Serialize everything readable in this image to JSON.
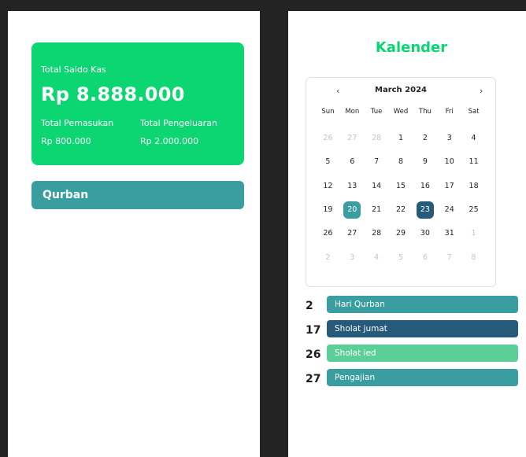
{
  "left": {
    "saldo": {
      "label": "Total Saldo Kas",
      "value": "Rp 8.888.000",
      "pemasukan_label": "Total Pemasukan",
      "pemasukan_value": "Rp 800.000",
      "pengeluaran_label": "Total Pengeluaran",
      "pengeluaran_value": "Rp 2.000.000"
    },
    "qurban_label": "Qurban"
  },
  "right": {
    "title": "Kalender",
    "calendar": {
      "prev": "‹",
      "next": "›",
      "month": "March 2024",
      "dow": [
        "Sun",
        "Mon",
        "Tue",
        "Wed",
        "Thu",
        "Fri",
        "Sat"
      ],
      "weeks": [
        [
          {
            "d": "26",
            "m": true
          },
          {
            "d": "27",
            "m": true
          },
          {
            "d": "28",
            "m": true
          },
          {
            "d": "1"
          },
          {
            "d": "2"
          },
          {
            "d": "3"
          },
          {
            "d": "4"
          }
        ],
        [
          {
            "d": "5"
          },
          {
            "d": "6"
          },
          {
            "d": "7"
          },
          {
            "d": "8"
          },
          {
            "d": "9"
          },
          {
            "d": "10"
          },
          {
            "d": "11"
          }
        ],
        [
          {
            "d": "12"
          },
          {
            "d": "13"
          },
          {
            "d": "14"
          },
          {
            "d": "15"
          },
          {
            "d": "16"
          },
          {
            "d": "17"
          },
          {
            "d": "18"
          }
        ],
        [
          {
            "d": "19"
          },
          {
            "d": "20",
            "s": "1"
          },
          {
            "d": "21"
          },
          {
            "d": "22"
          },
          {
            "d": "23",
            "s": "2"
          },
          {
            "d": "24"
          },
          {
            "d": "25"
          }
        ],
        [
          {
            "d": "26"
          },
          {
            "d": "27"
          },
          {
            "d": "28"
          },
          {
            "d": "29"
          },
          {
            "d": "30"
          },
          {
            "d": "31"
          },
          {
            "d": "1",
            "m": true
          }
        ],
        [
          {
            "d": "2",
            "m": true
          },
          {
            "d": "3",
            "m": true
          },
          {
            "d": "4",
            "m": true
          },
          {
            "d": "5",
            "m": true
          },
          {
            "d": "6",
            "m": true
          },
          {
            "d": "7",
            "m": true
          },
          {
            "d": "8",
            "m": true
          }
        ]
      ]
    },
    "events": [
      {
        "date": "2",
        "label": "Hari Qurban",
        "color": "#3a9ea0"
      },
      {
        "date": "17",
        "label": "Sholat jumat",
        "color": "#265a7a"
      },
      {
        "date": "26",
        "label": "Sholat ied",
        "color": "#5bcf97"
      },
      {
        "date": "27",
        "label": "Pengajian",
        "color": "#3a9ea0"
      }
    ]
  },
  "colors": {
    "accent": "#0bd672",
    "teal": "#3a9ea0",
    "navy": "#265a7a",
    "light_green": "#5bcf97"
  }
}
